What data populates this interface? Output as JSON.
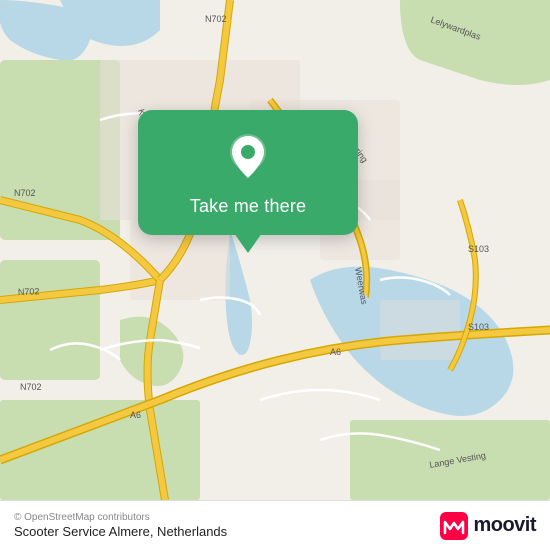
{
  "map": {
    "center": "Almere, Netherlands",
    "popup": {
      "label": "Take me there",
      "icon": "location-pin"
    }
  },
  "footer": {
    "attribution": "© OpenStreetMap contributors",
    "location_name": "Scooter Service Almere, Netherlands"
  },
  "moovit": {
    "text": "moovit"
  },
  "road_labels": {
    "n702_west": "N702",
    "n702_north": "N702",
    "n702_south": "N702",
    "n702_sw": "N702",
    "a6": "A6",
    "s103": "S103",
    "lelystad": "Lelywardplas",
    "lange_vesting": "Lange Vesting",
    "weerwas": "Weerwas",
    "buitenring": "Buitenring"
  }
}
